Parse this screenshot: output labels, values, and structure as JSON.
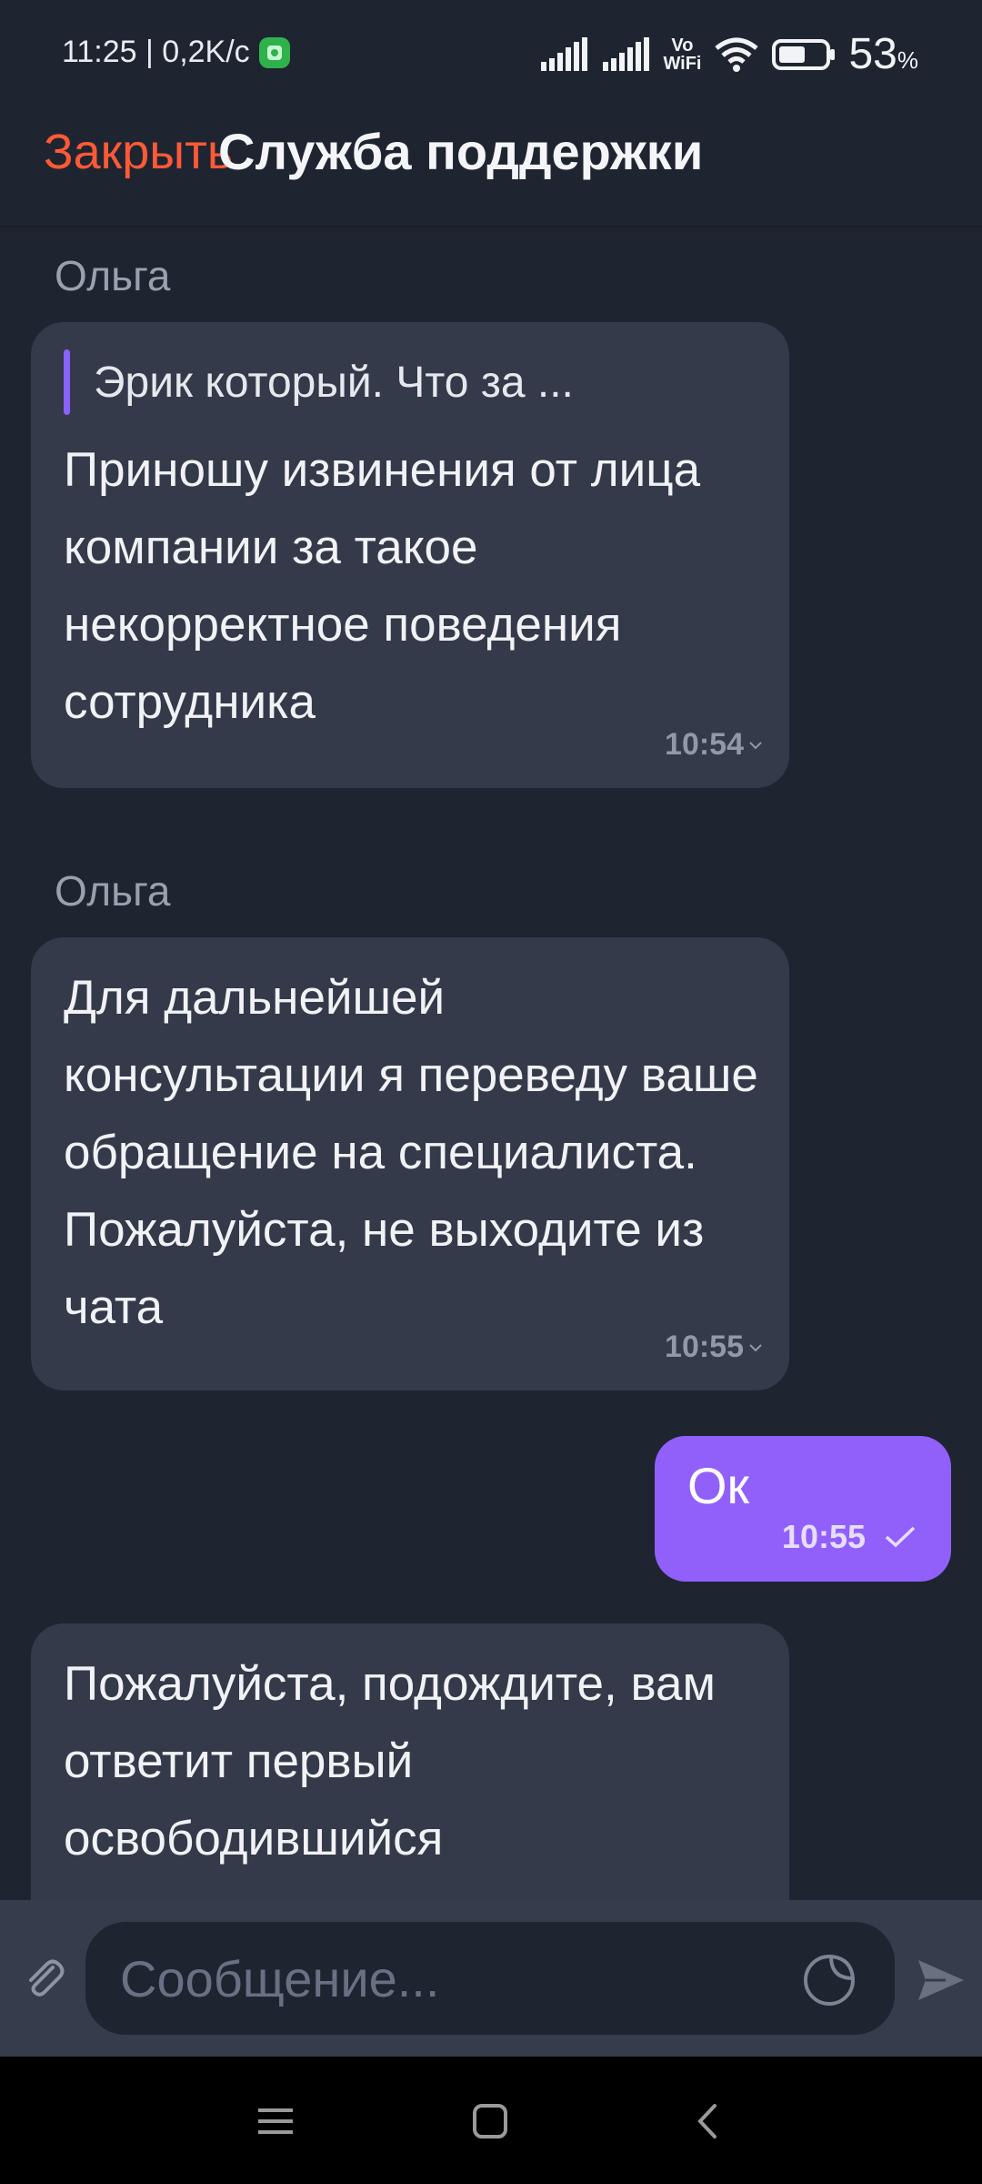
{
  "status_bar": {
    "time_speed": "11:25 | 0,2K/c",
    "vowifi_top": "Vo",
    "vowifi_bottom": "WiFi",
    "battery_value": "53",
    "battery_unit": "%"
  },
  "header": {
    "close_label": "Закрыть",
    "title": "Служба поддержки"
  },
  "messages": [
    {
      "sender": "Ольга",
      "quote": "Эрик который. Что за ...",
      "text": "Приношу извинения от лица компании за такое некорректное поведения сотрудника",
      "time": "10:54"
    },
    {
      "sender": "Ольга",
      "text": "Для дальнейшей консультации я переведу ваше обращение на специалиста. Пожалуйста, не выходите из чата",
      "time": "10:55"
    },
    {
      "outgoing": true,
      "text": "Ок",
      "time": "10:55"
    },
    {
      "text": "Пожалуйста, подождите, вам ответит первый освободившийся"
    }
  ],
  "composer": {
    "placeholder": "Сообщение..."
  },
  "colors": {
    "accent": "#ff5a36",
    "outgoing_bubble": "#9160fb",
    "incoming_bubble": "#343a49",
    "background": "#1f2431"
  },
  "icons": [
    "signal-icon",
    "wifi-icon",
    "battery-icon",
    "attach-icon",
    "sticker-icon",
    "send-icon",
    "menu-icon",
    "home-icon",
    "back-icon"
  ]
}
